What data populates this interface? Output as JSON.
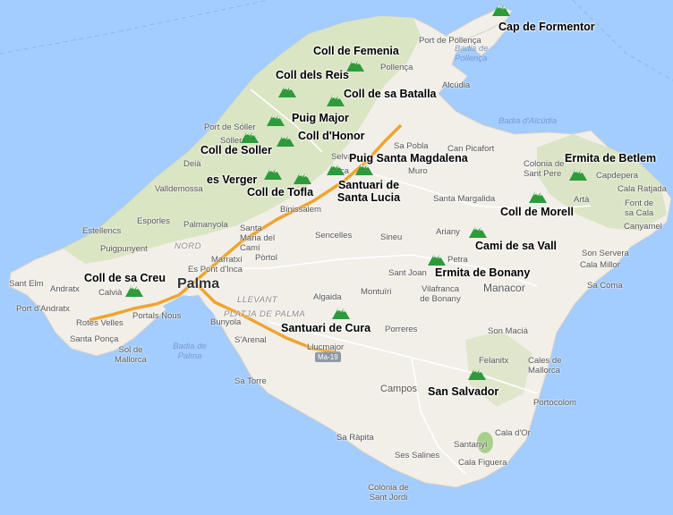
{
  "map": {
    "colors": {
      "sea": "#a3ccff",
      "land": "#f2efe9",
      "mountain": "#d7e3bf",
      "road": "#f0a42f",
      "marker": "#2e9a3c"
    },
    "marker_icon": "mountain-peak-icon",
    "markers": [
      {
        "label": "Cap de Formentor"
      },
      {
        "label": "Coll de Femenia"
      },
      {
        "label": "Coll dels Reis"
      },
      {
        "label": "Coll de sa Batalla"
      },
      {
        "label": "Puig Major"
      },
      {
        "label": "Coll d'Honor"
      },
      {
        "label": "Coll de Soller"
      },
      {
        "label": "Puig Santa Magdalena"
      },
      {
        "label": "Santuari de Santa Lucia"
      },
      {
        "label": "es Verger"
      },
      {
        "label": "Coll de Tofla"
      },
      {
        "label": "Ermita de Betlem"
      },
      {
        "label": "Coll de Morell"
      },
      {
        "label": "Cami de sa Vall"
      },
      {
        "label": "Ermita de Bonany"
      },
      {
        "label": "Coll de sa Creu"
      },
      {
        "label": "Santuari de Cura"
      },
      {
        "label": "San Salvador"
      }
    ],
    "places": [
      "Port de Pollença",
      "Badia de Pollença",
      "Pollença",
      "Alcúdia",
      "Badia d'Alcúdia",
      "Port de Sóller",
      "Sóller",
      "Deià",
      "Valldemossa",
      "Esporles",
      "Estellencs",
      "Palmanyola",
      "Puigpunyent",
      "NORD",
      "Santa Maria del Camí",
      "Pòrtol",
      "Marratxí",
      "Es Pont d'Inca",
      "Palma",
      "LLEVANT",
      "PLATJA DE PALMA",
      "Bunyola",
      "Binissalem",
      "Selva",
      "Inca",
      "Sa Pobla",
      "Muro",
      "Can Picafort",
      "Santa Margalida",
      "Sencelles",
      "Sineu",
      "Ariany",
      "Petra",
      "Sant Joan",
      "Vilafranca de Bonany",
      "Manacor",
      "Algaida",
      "Montuïri",
      "Porreres",
      "Llucmajor",
      "Ma-19",
      "S'Arenal",
      "Sa Torre",
      "Campos",
      "Felanitx",
      "Son Macià",
      "Cales de Mallorca",
      "Portocolom",
      "Cala d'Or",
      "Sa Ràpita",
      "Ses Salines",
      "Santanyí",
      "Cala Figuera",
      "Colònia de Sant Jordi",
      "Sant Elm",
      "Andratx",
      "Port d'Andratx",
      "Calvià",
      "Rotes Velles",
      "Portals Nous",
      "Santa Ponça",
      "Sol de Mallorca",
      "Badia de Palma",
      "Colonia de Sant Pere",
      "Artà",
      "Capdepera",
      "Cala Ratjada",
      "Font de sa Cala",
      "Canyamel",
      "Son Servera",
      "Cala Millor",
      "Sa Coma"
    ]
  }
}
